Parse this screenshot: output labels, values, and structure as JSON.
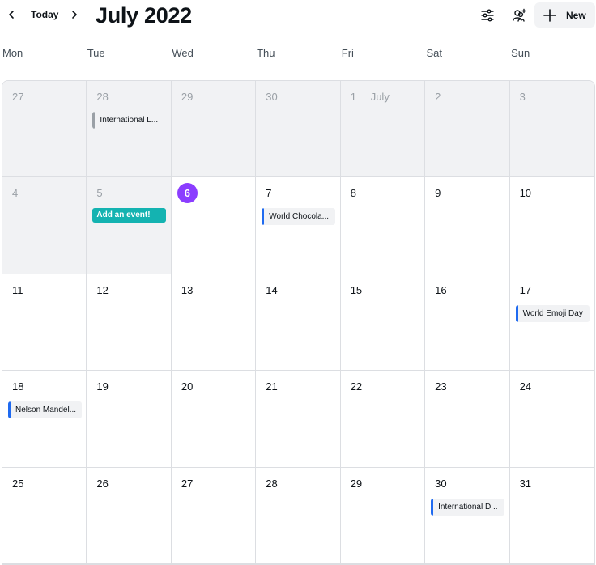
{
  "toolbar": {
    "today_label": "Today",
    "month_title": "July 2022",
    "new_label": "New",
    "prev_icon": "chevron-left-icon",
    "next_icon": "chevron-right-icon",
    "filter_icon": "sliders-icon",
    "people_icon": "people-add-icon",
    "new_icon": "plus-icon"
  },
  "weekdays": [
    "Mon",
    "Tue",
    "Wed",
    "Thu",
    "Fri",
    "Sat",
    "Sun"
  ],
  "colors": {
    "today": "#8b3dff",
    "add_event": "#14b3b1",
    "event_bar": "#1f6af0"
  },
  "days": [
    {
      "num": "27"
    },
    {
      "num": "28"
    },
    {
      "num": "29"
    },
    {
      "num": "30"
    },
    {
      "num": "1",
      "month_label": "July"
    },
    {
      "num": "2"
    },
    {
      "num": "3"
    },
    {
      "num": "4"
    },
    {
      "num": "5"
    },
    {
      "num": "6"
    },
    {
      "num": "7"
    },
    {
      "num": "8"
    },
    {
      "num": "9"
    },
    {
      "num": "10"
    },
    {
      "num": "11"
    },
    {
      "num": "12"
    },
    {
      "num": "13"
    },
    {
      "num": "14"
    },
    {
      "num": "15"
    },
    {
      "num": "16"
    },
    {
      "num": "17"
    },
    {
      "num": "18"
    },
    {
      "num": "19"
    },
    {
      "num": "20"
    },
    {
      "num": "21"
    },
    {
      "num": "22"
    },
    {
      "num": "23"
    },
    {
      "num": "24"
    },
    {
      "num": "25"
    },
    {
      "num": "26"
    },
    {
      "num": "27"
    },
    {
      "num": "28"
    },
    {
      "num": "29"
    },
    {
      "num": "30"
    },
    {
      "num": "31"
    }
  ],
  "events": {
    "international_l": "International L...",
    "add_event": "Add an event!",
    "world_chocolate": "World Chocola...",
    "world_emoji": "World Emoji Day",
    "nelson_mandela": "Nelson Mandel...",
    "international_d": "International D..."
  }
}
